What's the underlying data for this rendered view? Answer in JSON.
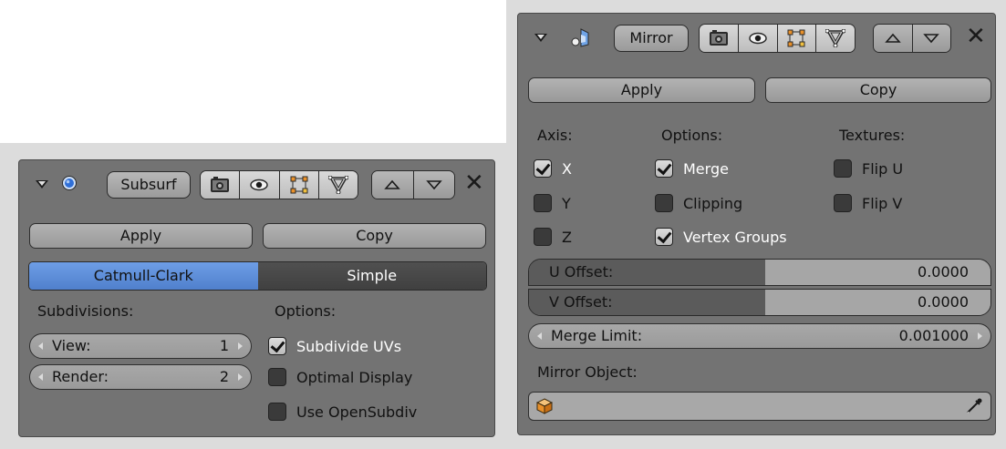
{
  "subsurf": {
    "name": "Subsurf",
    "apply_label": "Apply",
    "copy_label": "Copy",
    "method_options": [
      "Catmull-Clark",
      "Simple"
    ],
    "selected_method": "Catmull-Clark",
    "subdivisions_label": "Subdivisions:",
    "view_label": "View:",
    "view_value": "1",
    "render_label": "Render:",
    "render_value": "2",
    "options_label": "Options:",
    "options": [
      {
        "label": "Subdivide UVs",
        "checked": true
      },
      {
        "label": "Optimal Display",
        "checked": false
      },
      {
        "label": "Use OpenSubdiv",
        "checked": false
      }
    ]
  },
  "mirror": {
    "name": "Mirror",
    "apply_label": "Apply",
    "copy_label": "Copy",
    "axis_label": "Axis:",
    "axis": [
      {
        "label": "X",
        "checked": true
      },
      {
        "label": "Y",
        "checked": false
      },
      {
        "label": "Z",
        "checked": false
      }
    ],
    "options_label": "Options:",
    "options": [
      {
        "label": "Merge",
        "checked": true
      },
      {
        "label": "Clipping",
        "checked": false
      },
      {
        "label": "Vertex Groups",
        "checked": true
      }
    ],
    "textures_label": "Textures:",
    "textures": [
      {
        "label": "Flip U",
        "checked": false
      },
      {
        "label": "Flip V",
        "checked": false
      }
    ],
    "u_offset_label": "U Offset:",
    "u_offset_value": "0.0000",
    "v_offset_label": "V Offset:",
    "v_offset_value": "0.0000",
    "merge_limit_label": "Merge Limit:",
    "merge_limit_value": "0.001000",
    "mirror_object_label": "Mirror Object:",
    "mirror_object_value": ""
  },
  "icons": {
    "collapse": "disclosure-triangle-icon",
    "subsurf_modifier": "subsurf-modifier-icon",
    "mirror_modifier": "mirror-modifier-icon",
    "render": "camera-icon",
    "viewport": "eye-icon",
    "edit_mode": "edit-mode-icon",
    "cage": "cage-mesh-icon",
    "move_up": "arrow-up-icon",
    "move_down": "arrow-down-icon",
    "remove": "close-icon",
    "object": "object-cube-icon",
    "eyedropper": "eyedropper-icon"
  },
  "colors": {
    "panel_bg": "#737373",
    "accent_blue": "#5a8ad8",
    "orange_icon": "#e8902a"
  }
}
